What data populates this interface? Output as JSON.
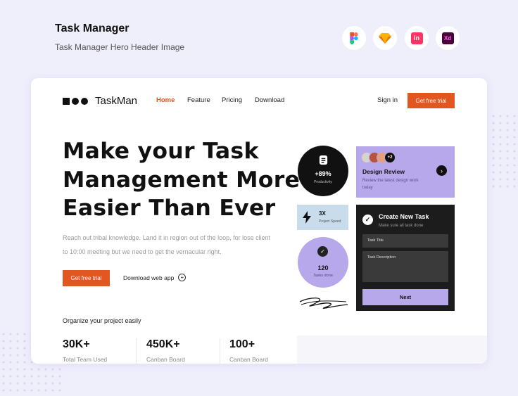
{
  "header": {
    "title": "Task Manager",
    "subtitle": "Task Manager Hero Header Image"
  },
  "tools": [
    {
      "name": "figma-icon"
    },
    {
      "name": "sketch-icon"
    },
    {
      "name": "invision-icon",
      "label": "in"
    },
    {
      "name": "adobe-xd-icon",
      "label": "Xd"
    }
  ],
  "site": {
    "logo_text": "TaskMan",
    "nav": [
      "Home",
      "Feature",
      "Pricing",
      "Download"
    ],
    "sign_in": "Sign in",
    "cta": "Get free trial"
  },
  "hero": {
    "headline_lines": [
      "Make your Task",
      "Management More",
      "Easier Than Ever"
    ],
    "paragraph": "Reach out tribal knowledge. Land it in region out of the loop, for lose client to 10:00 meeting but we need to get the vernacular right.",
    "primary_button": "Get free trial",
    "secondary_button": "Download web app"
  },
  "stats": {
    "heading": "Organize your project easily",
    "items": [
      {
        "value": "30K+",
        "label": "Total Team Used"
      },
      {
        "value": "450K+",
        "label": "Canban Board"
      },
      {
        "value": "100+",
        "label": "Canban Board"
      }
    ]
  },
  "widgets": {
    "productivity": {
      "value": "+89%",
      "label": "Productivity"
    },
    "design_review": {
      "more_count": "+2",
      "title": "Design Review",
      "desc": "Review the latest design work today"
    },
    "speed": {
      "value": "3X",
      "label": "Project Speed"
    },
    "tasks": {
      "value": "120",
      "label": "Tasks done"
    },
    "create_task": {
      "title": "Create New Task",
      "subtitle": "Make sure all task done",
      "field_title": "Task Title",
      "field_desc": "Task Description",
      "button": "Next"
    }
  },
  "colors": {
    "accent": "#e1571f",
    "lavender": "#b7a8ec",
    "background": "#efeefb",
    "dark": "#1c1c1c",
    "light_blue": "#c9dcec"
  }
}
